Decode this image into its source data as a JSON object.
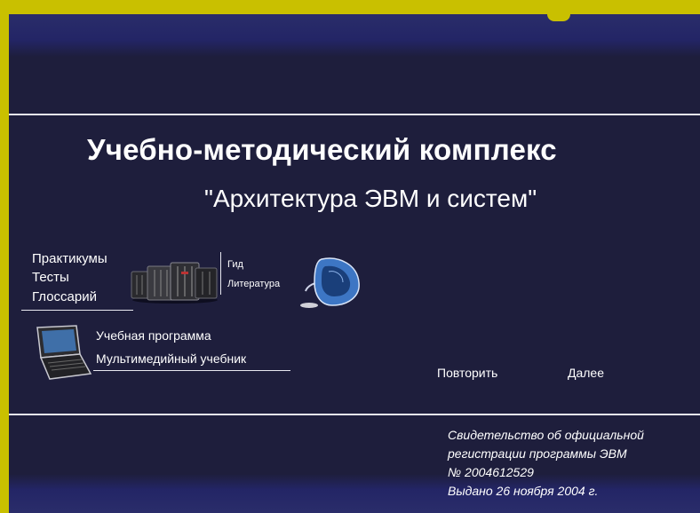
{
  "header": {
    "title": "Учебно-методический комплекс",
    "subtitle": "\"Архитектура ЭВМ и систем\""
  },
  "menu_left": {
    "items": [
      "Практикумы",
      "Тесты",
      "Глоссарий"
    ]
  },
  "menu_middle": {
    "items": [
      "Гид",
      "Литература"
    ]
  },
  "menu_bottom": {
    "items": [
      "Учебная программа",
      "Мультимедийный учебник"
    ]
  },
  "nav": {
    "repeat_label": "Повторить",
    "next_label": "Далее"
  },
  "certificate": {
    "lines": [
      "Свидетельство об официальной",
      "регистрации программы ЭВМ",
      "№ 2004612529",
      "Выдано 26 ноября 2004 г."
    ]
  },
  "colors": {
    "frame": "#c9c000",
    "background": "#1e1e3c",
    "band": "#2a2d6a",
    "text": "#ffffff"
  },
  "icons": [
    "server-rack-icon",
    "imac-computer-icon",
    "laptop-icon"
  ]
}
